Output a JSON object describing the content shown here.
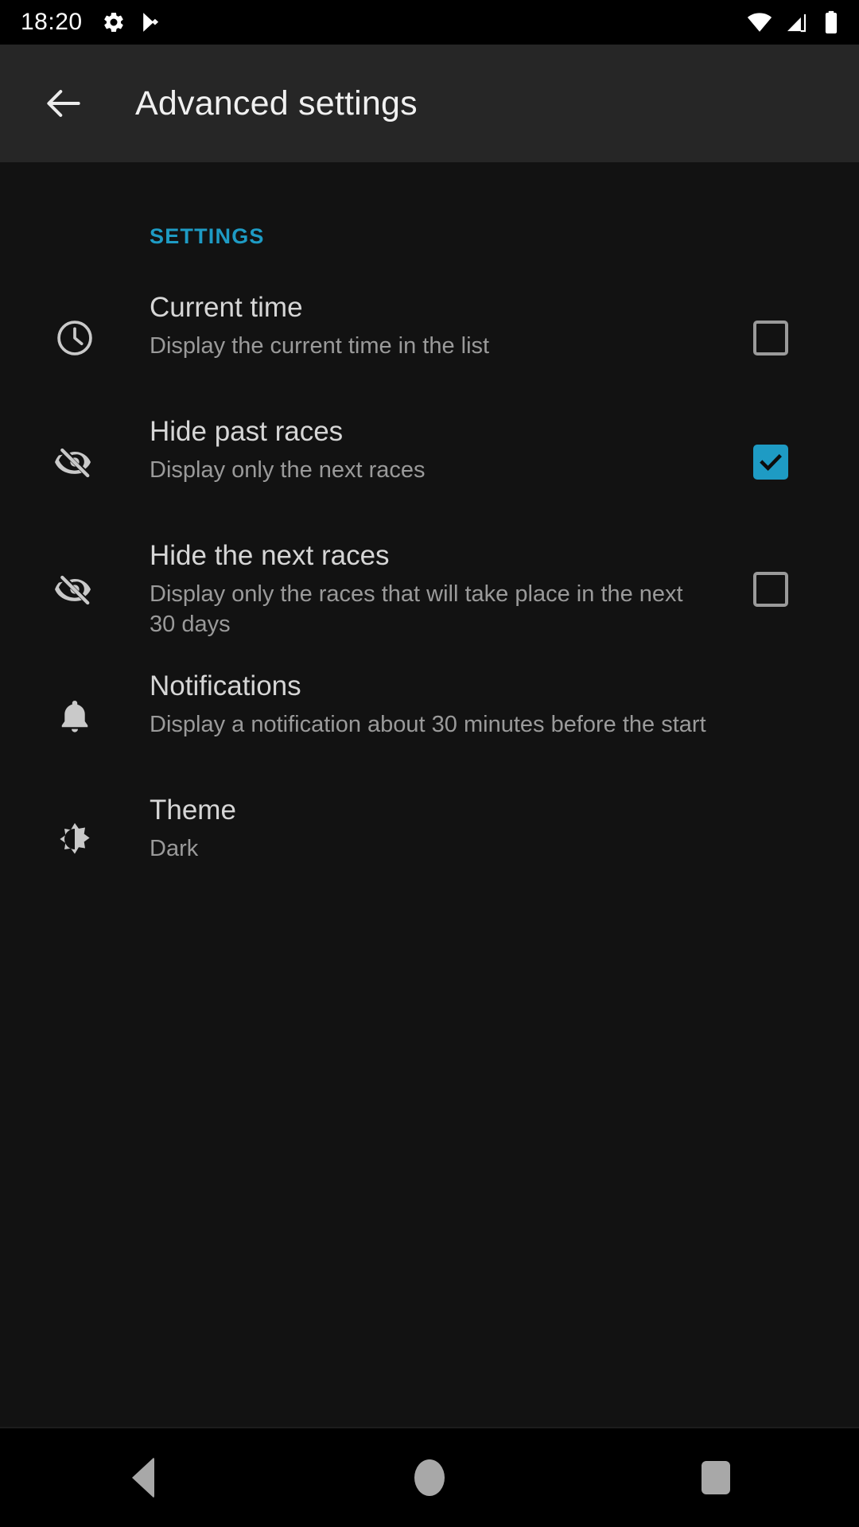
{
  "status_bar": {
    "time": "18:20",
    "left_icons": [
      "gear-icon",
      "play-store-icon"
    ],
    "right_icons": [
      "wifi-icon",
      "cellular-signal-icon",
      "battery-icon"
    ]
  },
  "app_bar": {
    "back_icon": "arrow-left-icon",
    "title": "Advanced settings"
  },
  "section": {
    "header": "SETTINGS"
  },
  "rows": [
    {
      "id": "current-time",
      "icon": "clock-icon",
      "title": "Current time",
      "subtitle": "Display the current time in the list",
      "control": "checkbox",
      "checked": false
    },
    {
      "id": "hide-past-races",
      "icon": "eye-off-icon",
      "title": "Hide past races",
      "subtitle": "Display only the next races",
      "control": "checkbox",
      "checked": true
    },
    {
      "id": "hide-next-races",
      "icon": "eye-off-icon",
      "title": "Hide the next races",
      "subtitle": "Display only the races that will take place in the next 30 days",
      "control": "checkbox",
      "checked": false
    },
    {
      "id": "notifications",
      "icon": "bell-icon",
      "title": "Notifications",
      "subtitle": "Display a notification about 30 minutes before the start",
      "control": "none",
      "checked": false
    },
    {
      "id": "theme",
      "icon": "brightness-icon",
      "title": "Theme",
      "subtitle": "Dark",
      "control": "none",
      "checked": false
    }
  ],
  "nav_bar": {
    "back": "nav-back-icon",
    "home": "nav-home-icon",
    "recents": "nav-recents-icon"
  },
  "colors": {
    "accent": "#1e9bc4",
    "app_bar_bg": "#262626",
    "content_bg": "#121212",
    "title_text": "#d6d6d6",
    "subtitle_text": "#9a9a9a"
  }
}
